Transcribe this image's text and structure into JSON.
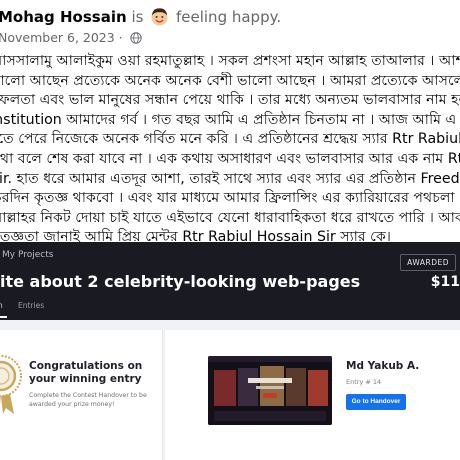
{
  "post": {
    "author": "Mohag Hossain",
    "is_text": "is",
    "feeling_text": "feeling happy.",
    "date": "November 6, 2023 ·",
    "body_lines": [
      "আসসালামু আলাইকুম ওয়া রহমাতুল্লাহ । সকল প্রশংসা মহান আল্লাহ তাআলার । আশাকরছি তা",
      "ভালো আছেন প্রত্যেকে অনেক অনেক বেশী ভালো আছেন । আমরা প্রত্যেকে আসলে কোন কে",
      "সফলতা এবং ভাল মানুষের সন্ধান পেয়ে থাকি । তার মধ্যে অন্যতম ভালবাসার নাম হল Freedom",
      "Institution আমাদের গর্ব । গত বছর আমি এ প্রতিষ্ঠান চিনতাম না । আজ আমি এ পরিবারের এ",
      "হতে পেরে নিজেকে অনেক গর্বিত মনে করি । এ প্রতিষ্ঠানের শ্রদ্ধেয় স্যার Rtr Rabiul Hos",
      "কথা বলে শেষ করা যাবে না । এক কথায় অসাধারণ এবং ভালবাসার আর এক নাম Rtr Rabiu",
      "Sir. হাত ধরে আমার এতদূর আশা, তারই সাথে স্যার এবং স্যার এর প্রতিষ্ঠান Freedom it Ins",
      "চিরদিন কৃতজ্ঞ থাকবো । এবং যার মাধ্যমে আমার ফ্রিলান্সিং এর ক্যারিয়ারের পথচলা । পরিশে",
      "আল্লাহর নিকট দোয়া চাই যাতে এইভাবে যেনো ধারাবাহিকতা ধরে রাখতে পারি । আবারো ধন্যবাদ",
      "কৃতজ্ঞতা জানাই আমি প্রিয় মেন্টর Rtr Rabiul Hossain Sir স্যার কে।"
    ]
  },
  "embed": {
    "breadcrumb": "My Projects",
    "badge": "AWARDED",
    "title": "ite about 2 celebrity-looking web-pages",
    "prize": "$11",
    "tabs": [
      "n",
      "Entries"
    ],
    "congrats_title": "Congratulations on your winning entry",
    "congrats_subtitle": "Complete the Contest Handover to be awarded your prize money!",
    "winner_name": "Md Yakub A.",
    "entry_number": "Entry # 14",
    "handover_button": "Go to Handover",
    "colors": {
      "header_bg": "#1a1b22",
      "button": "#1472eb",
      "trophy": "#c9a85c"
    }
  }
}
